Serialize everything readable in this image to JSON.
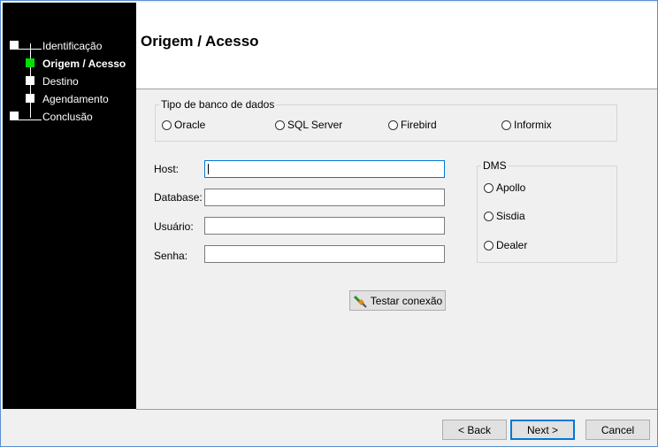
{
  "wizard": {
    "steps": [
      {
        "label": "Identificação"
      },
      {
        "label": "Origem / Acesso"
      },
      {
        "label": "Destino"
      },
      {
        "label": "Agendamento"
      },
      {
        "label": "Conclusão"
      }
    ],
    "active_step_color": "#00e000"
  },
  "header": {
    "title": "Origem / Acesso"
  },
  "db_type": {
    "title": "Tipo de banco de dados",
    "options": [
      "Oracle",
      "SQL Server",
      "Firebird",
      "Informix"
    ]
  },
  "form": {
    "host_label": "Host:",
    "host_value": "",
    "database_label": "Database:",
    "database_value": "",
    "user_label": "Usuário:",
    "user_value": "",
    "password_label": "Senha:",
    "password_value": ""
  },
  "dms": {
    "title": "DMS",
    "options": [
      "Apollo",
      "Sisdia",
      "Dealer"
    ]
  },
  "test_button": {
    "label": "Testar conexão",
    "icon": "plug-icon"
  },
  "nav": {
    "back_label": "< Back",
    "next_label": "Next >",
    "cancel_label": "Cancel"
  }
}
